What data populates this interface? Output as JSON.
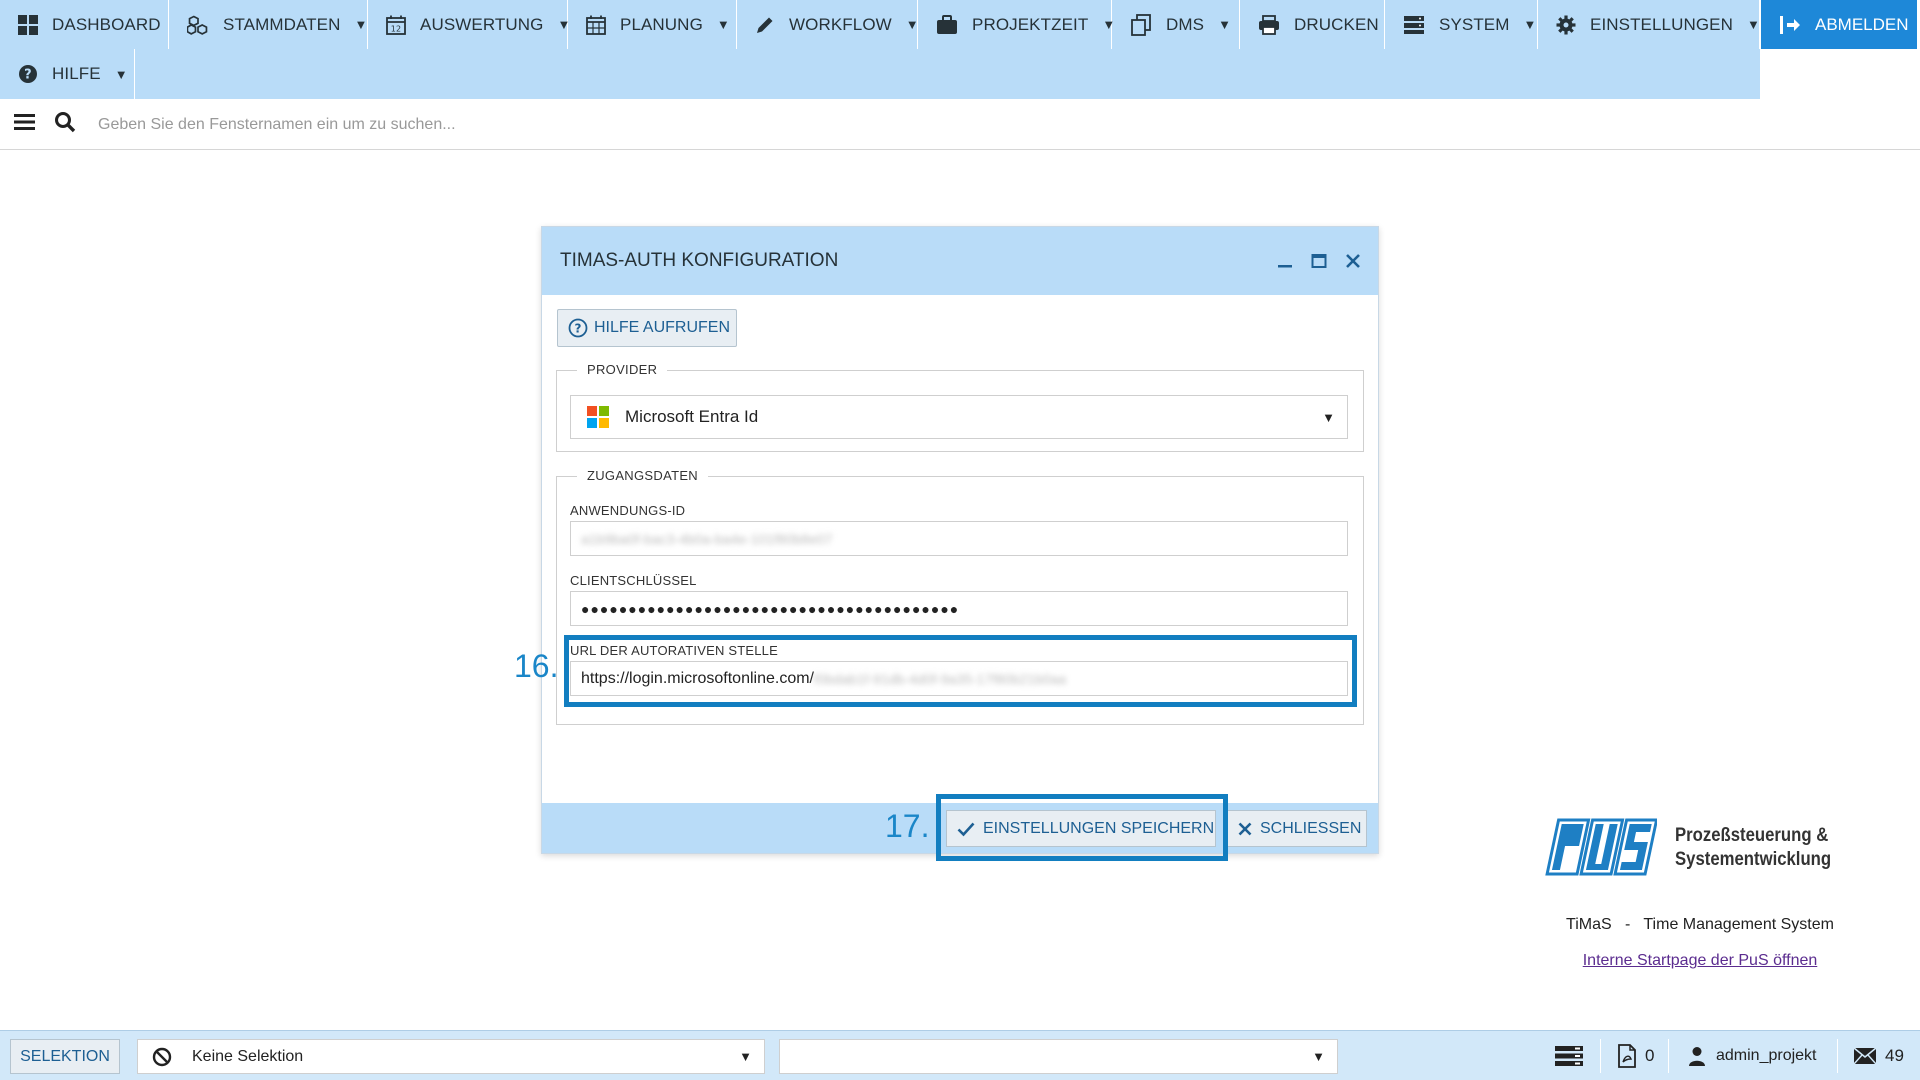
{
  "menu": {
    "items": [
      {
        "label": "DASHBOARD",
        "icon": "dashboard-icon",
        "caret": false
      },
      {
        "label": "STAMMDATEN",
        "icon": "cubes-icon",
        "caret": true
      },
      {
        "label": "AUSWERTUNG",
        "icon": "calendar-icon",
        "caret": true
      },
      {
        "label": "PLANUNG",
        "icon": "calendar-grid-icon",
        "caret": true
      },
      {
        "label": "WORKFLOW",
        "icon": "pencil-icon",
        "caret": true
      },
      {
        "label": "PROJEKTZEIT",
        "icon": "briefcase-icon",
        "caret": true
      },
      {
        "label": "DMS",
        "icon": "documents-icon",
        "caret": true
      },
      {
        "label": "DRUCKEN",
        "icon": "printer-icon",
        "caret": false
      },
      {
        "label": "SYSTEM",
        "icon": "server-icon",
        "caret": true
      },
      {
        "label": "EINSTELLUNGEN",
        "icon": "gear-icon",
        "caret": true
      }
    ],
    "help": "HILFE",
    "logout": "ABMELDEN"
  },
  "search": {
    "placeholder": "Geben Sie den Fensternamen ein um zu suchen..."
  },
  "dialog": {
    "title": "TIMAS-AUTH KONFIGURATION",
    "help_button": "HILFE AUFRUFEN",
    "provider_group": "PROVIDER",
    "provider_value": "Microsoft Entra Id",
    "credentials_group": "ZUGANGSDATEN",
    "app_id_label": "ANWENDUNGS-ID",
    "app_id_value": "a1b9ba0f-bac3-4b0a-ba4e-101f80b8e07",
    "client_key_label": "CLIENTSCHLÜSSEL",
    "client_key_value": "●●●●●●●●●●●●●●●●●●●●●●●●●●●●●●●●●●●●●●●●",
    "authority_label": "URL DER AUTORATIVEN STELLE",
    "authority_value_prefix": "https://login.microsoftonline.com/",
    "authority_value_hidden": "f0bdab1f-91db-4d0f-9a35-17f80b21b0aa",
    "save_button": "EINSTELLUNGEN SPEICHERN",
    "close_button": "SCHLIESSEN"
  },
  "annotations": {
    "step16": "16.",
    "step17": "17.",
    "highlight_color": "#127ec0"
  },
  "brand": {
    "line1": "Prozeßsteuerung &",
    "line2": "Systementwicklung",
    "tagline": "TiMaS   -   Time Management System",
    "start_link": "Interne Startpage der PuS öffnen"
  },
  "statusbar": {
    "selection_button": "SELEKTION",
    "selection_value": "Keine Selektion",
    "second_select_value": "",
    "pdf_count": "0",
    "user": "admin_projekt",
    "mail_count": "49"
  },
  "colors": {
    "menu_bg": "#b9dcf8",
    "logout_bg": "#1e88d8",
    "accent": "#1d5f93"
  }
}
